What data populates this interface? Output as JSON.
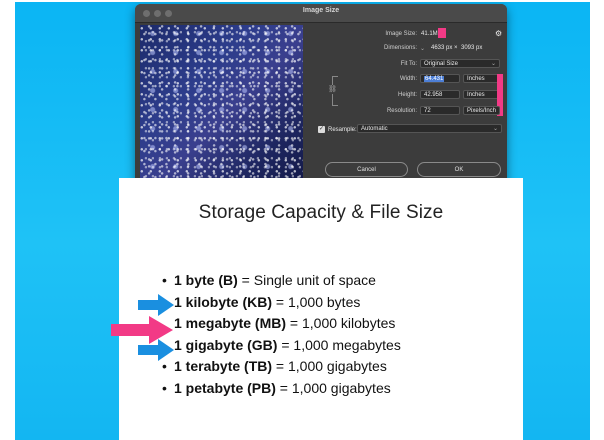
{
  "dialog": {
    "title": "Image Size",
    "image_size_label": "Image Size:",
    "image_size_value": "41.1M",
    "dimensions_label": "Dimensions:",
    "dimensions_w": "4633 px",
    "dimensions_x": "×",
    "dimensions_h": "3093 px",
    "fit_to_label": "Fit To:",
    "fit_to_value": "Original Size",
    "width_label": "Width:",
    "width_value": "64.431",
    "width_unit": "Inches",
    "height_label": "Height:",
    "height_value": "42.958",
    "height_unit": "Inches",
    "resolution_label": "Resolution:",
    "resolution_value": "72",
    "resolution_unit": "Pixels/Inch",
    "resample_label": "Resample:",
    "resample_value": "Automatic",
    "cancel_label": "Cancel",
    "ok_label": "OK",
    "accent_color": "#f23a86"
  },
  "slide": {
    "title": "Storage Capacity & File Size",
    "bullets": [
      {
        "bold": "1 byte (B)",
        "rest": " = Single unit of space",
        "marker": "dot"
      },
      {
        "bold": "1 kilobyte (KB)",
        "rest": " = 1,000 bytes",
        "marker": "blue-arrow"
      },
      {
        "bold": "1 megabyte (MB)",
        "rest": " = 1,000 kilobytes",
        "marker": "pink-arrow"
      },
      {
        "bold": "1 gigabyte (GB)",
        "rest": " = 1,000 megabytes",
        "marker": "blue-arrow"
      },
      {
        "bold": "1 terabyte (TB)",
        "rest": " = 1,000 gigabytes",
        "marker": "dot"
      },
      {
        "bold": "1 petabyte (PB)",
        "rest": " = 1,000 gigabytes",
        "marker": "dot"
      }
    ],
    "bullet_char": "•",
    "blue_arrow_color": "#1a8fe0",
    "pink_arrow_color": "#f23a86"
  }
}
